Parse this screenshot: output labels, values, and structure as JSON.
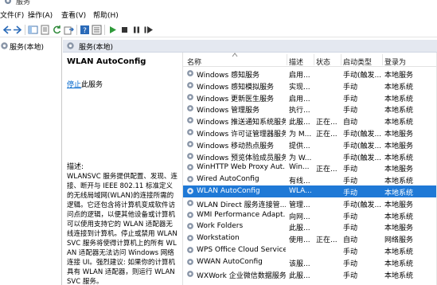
{
  "window": {
    "title": "服务"
  },
  "menu": [
    {
      "label": "文件(F)"
    },
    {
      "label": "操作(A)"
    },
    {
      "label": "查看(V)"
    },
    {
      "label": "帮助(H)"
    }
  ],
  "tree": {
    "root_label": "服务(本地)"
  },
  "panel": {
    "header": "服务(本地)"
  },
  "details": {
    "service_name": "WLAN AutoConfig",
    "stop_link": "停止",
    "stop_suffix": "此服务",
    "description_label": "描述:",
    "description_text": "WLANSVC 服务提供配置、发现、连接、断开与 IEEE 802.11 标准定义的无线局域网(WLAN)的连接所需的逻辑。它还包含将计算机变成软件访问点的逻辑，以便其他设备或计算机可以使用支持它的 WLAN 适配器无线连接到计算机。停止或禁用 WLANSVC 服务将使得计算机上的所有 WLAN 适配器无法访问 Windows 网络连接 UI。强烈建议: 如果你的计算机具有 WLAN 适配器，则运行 WLANSVC 服务。"
  },
  "table": {
    "columns": {
      "name": "名称",
      "desc": "描述",
      "status": "状态",
      "start": "启动类型",
      "logon": "登录为"
    },
    "rows": [
      {
        "name": "Windows 感知服务",
        "desc": "启用...",
        "status": "",
        "start": "手动(触发...",
        "logon": "本地服务"
      },
      {
        "name": "Windows 感知模拟服务",
        "desc": "实现...",
        "status": "",
        "start": "手动",
        "logon": "本地系统"
      },
      {
        "name": "Windows 更新医生服务",
        "desc": "启用...",
        "status": "",
        "start": "手动",
        "logon": "本地系统"
      },
      {
        "name": "Windows 管理服务",
        "desc": "执行...",
        "status": "",
        "start": "手动",
        "logon": "本地系统"
      },
      {
        "name": "Windows 推送通知系统服务",
        "desc": "此服...",
        "status": "正在...",
        "start": "自动",
        "logon": "本地系统"
      },
      {
        "name": "Windows 许可证管理器服务",
        "desc": "为 M...",
        "status": "正在...",
        "start": "手动(触发...",
        "logon": "本地服务"
      },
      {
        "name": "Windows 移动热点服务",
        "desc": "提供...",
        "status": "",
        "start": "手动(触发...",
        "logon": "本地服务"
      },
      {
        "name": "Windows 预览体验成员服务",
        "desc": "为 W...",
        "status": "",
        "start": "手动(触发...",
        "logon": "本地系统"
      },
      {
        "name": "WinHTTP Web Proxy Aut...",
        "desc": "Win...",
        "status": "正在...",
        "start": "手动",
        "logon": "本地服务"
      },
      {
        "name": "Wired AutoConfig",
        "desc": "有线...",
        "status": "",
        "start": "手动",
        "logon": "本地系统"
      },
      {
        "name": "WLAN AutoConfig",
        "desc": "WLA...",
        "status": "",
        "start": "手动",
        "logon": "本地系统"
      },
      {
        "name": "WLAN Direct 服务连接管...",
        "desc": "管理...",
        "status": "",
        "start": "手动(触发...",
        "logon": "本地服务"
      },
      {
        "name": "WMI Performance Adapt...",
        "desc": "向网...",
        "status": "",
        "start": "手动",
        "logon": "本地系统"
      },
      {
        "name": "Work Folders",
        "desc": "此服...",
        "status": "",
        "start": "手动",
        "logon": "本地服务"
      },
      {
        "name": "Workstation",
        "desc": "使用...",
        "status": "正在...",
        "start": "自动",
        "logon": "网络服务"
      },
      {
        "name": "WPS Office Cloud Service",
        "desc": "",
        "status": "",
        "start": "手动",
        "logon": "本地系统"
      },
      {
        "name": "WWAN AutoConfig",
        "desc": "该服...",
        "status": "",
        "start": "手动",
        "logon": "本地系统"
      },
      {
        "name": "WXWork 企业微信数据服务",
        "desc": "此服...",
        "status": "",
        "start": "手动",
        "logon": "本地系统"
      }
    ],
    "selected_index": 10
  },
  "colors": {
    "selection": "#1f79d6",
    "link": "#0066cc",
    "header_strip": "#e4e8f0"
  },
  "icons": [
    "app-icon",
    "back-icon",
    "forward-icon",
    "console-tree-icon",
    "properties-icon",
    "refresh-icon",
    "export-icon",
    "help-icon",
    "view-icon",
    "start-icon",
    "stop-icon",
    "pause-icon",
    "restart-icon",
    "gear-icon",
    "sort-up-icon"
  ]
}
